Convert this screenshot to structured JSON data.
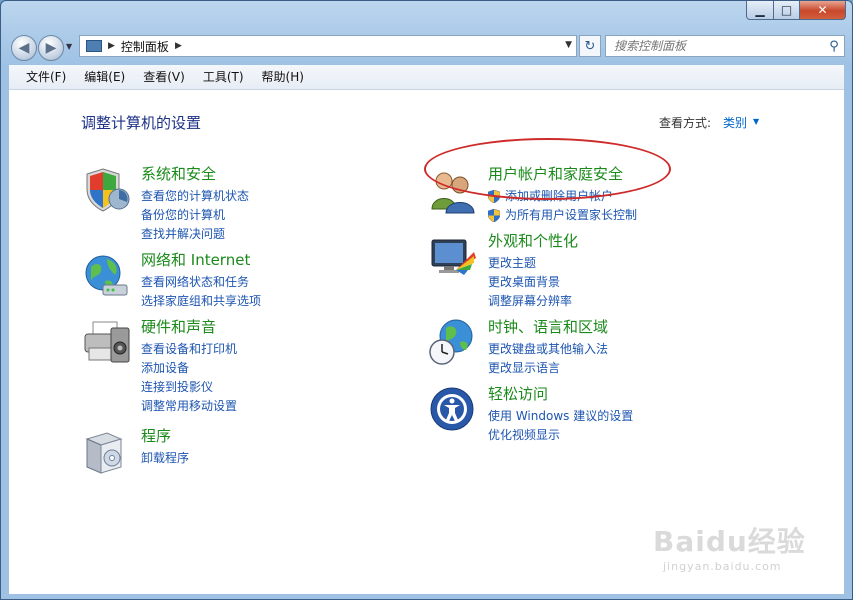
{
  "window": {
    "caption": {
      "minimize": "▁",
      "maximize": "□",
      "close": "✕"
    }
  },
  "nav": {
    "back_icon": "back-arrow-icon",
    "forward_icon": "forward-arrow-icon",
    "breadcrumb": "控制面板",
    "search_placeholder": "搜索控制面板"
  },
  "menu": [
    "文件(F)",
    "编辑(E)",
    "查看(V)",
    "工具(T)",
    "帮助(H)"
  ],
  "main": {
    "title": "调整计算机的设置",
    "view_by_label": "查看方式:",
    "view_by_value": "类别"
  },
  "categories": {
    "system": {
      "title": "系统和安全",
      "links": [
        "查看您的计算机状态",
        "备份您的计算机",
        "查找并解决问题"
      ]
    },
    "network": {
      "title": "网络和 Internet",
      "links": [
        "查看网络状态和任务",
        "选择家庭组和共享选项"
      ]
    },
    "hardware": {
      "title": "硬件和声音",
      "links": [
        "查看设备和打印机",
        "添加设备",
        "连接到投影仪",
        "调整常用移动设置"
      ]
    },
    "programs": {
      "title": "程序",
      "links": [
        "卸载程序"
      ]
    },
    "users": {
      "title": "用户帐户和家庭安全",
      "links": [
        "添加或删除用户帐户",
        "为所有用户设置家长控制"
      ]
    },
    "appearance": {
      "title": "外观和个性化",
      "links": [
        "更改主题",
        "更改桌面背景",
        "调整屏幕分辨率"
      ]
    },
    "clock": {
      "title": "时钟、语言和区域",
      "links": [
        "更改键盘或其他输入法",
        "更改显示语言"
      ]
    },
    "ease": {
      "title": "轻松访问",
      "links": [
        "使用 Windows 建议的设置",
        "优化视频显示"
      ]
    }
  },
  "watermark": {
    "logo": "Baidu经验",
    "sub": "jingyan.baidu.com"
  },
  "colors": {
    "category_title": "#1b8a1b",
    "link": "#1d55b0",
    "heading": "#1e3287",
    "annotation": "#cf2a2a"
  }
}
